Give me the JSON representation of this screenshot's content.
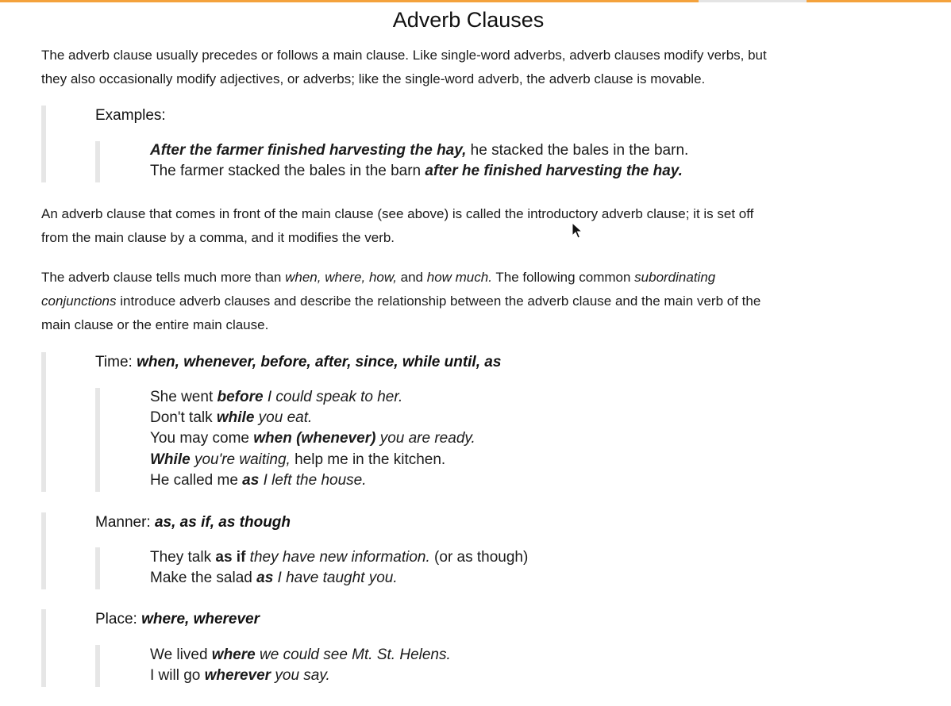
{
  "title": "Adverb Clauses",
  "intro": {
    "line1": "The adverb clause usually precedes or follows a main clause. Like single-word adverbs, adverb clauses modify verbs, but",
    "line2": "they also occasionally modify adjectives, or adverbs; like the single-word adverb, the adverb clause is movable."
  },
  "examples": {
    "heading": "Examples:",
    "ex1_clause": "After the farmer finished harvesting the hay,",
    "ex1_rest": " he stacked the bales in the barn.",
    "ex2_start": "The farmer stacked the bales in the barn ",
    "ex2_clause": "after he finished harvesting the hay."
  },
  "para2": {
    "line1": "An adverb clause that comes in front of the main clause (see above) is called the introductory adverb clause; it is set off",
    "line2": "from the main clause by a comma, and it modifies the verb."
  },
  "para3": {
    "p1": "The adverb clause tells much more than ",
    "p2": "when, where, how,",
    "p3": " and ",
    "p4": "how much.",
    "p5": " The following common ",
    "p6": "subordinating",
    "p7": "conjunctions",
    "p8": " introduce adverb clauses and describe the relationship between the adverb clause and the main verb of the",
    "p9": "main clause or the entire main clause."
  },
  "time": {
    "label": "Time: ",
    "words": "when, whenever, before, after, since, while until, as",
    "ex1a": "She went ",
    "ex1b": "before",
    "ex1c": " I could speak to her.",
    "ex2a": "Don't talk ",
    "ex2b": "while",
    "ex2c": " you eat.",
    "ex3a": "You may come ",
    "ex3b": "when (whenever)",
    "ex3c": " you are ready.",
    "ex4a": "While",
    "ex4b": " you're waiting,",
    "ex4c": " help me in the kitchen.",
    "ex5a": "He called me ",
    "ex5b": "as",
    "ex5c": " I left the house."
  },
  "manner": {
    "label": "Manner: ",
    "words": "as, as if, as though",
    "ex1a": "They talk ",
    "ex1b": "as if",
    "ex1c": " they have new information.",
    "ex1d": " (or as though)",
    "ex2a": "Make the salad ",
    "ex2b": "as",
    "ex2c": " I have taught you."
  },
  "place": {
    "label": "Place: ",
    "words": "where, wherever",
    "ex1a": "We lived ",
    "ex1b": "where",
    "ex1c": " we could see Mt. St. Helens.",
    "ex2a": "I will go ",
    "ex2b": "wherever",
    "ex2c": " you say."
  },
  "colors": {
    "accent": "#f4a23c",
    "quote_bar": "#e6e6e6",
    "text": "#1b1b1b"
  },
  "icons": {
    "cursor": "mouse-pointer-icon"
  }
}
